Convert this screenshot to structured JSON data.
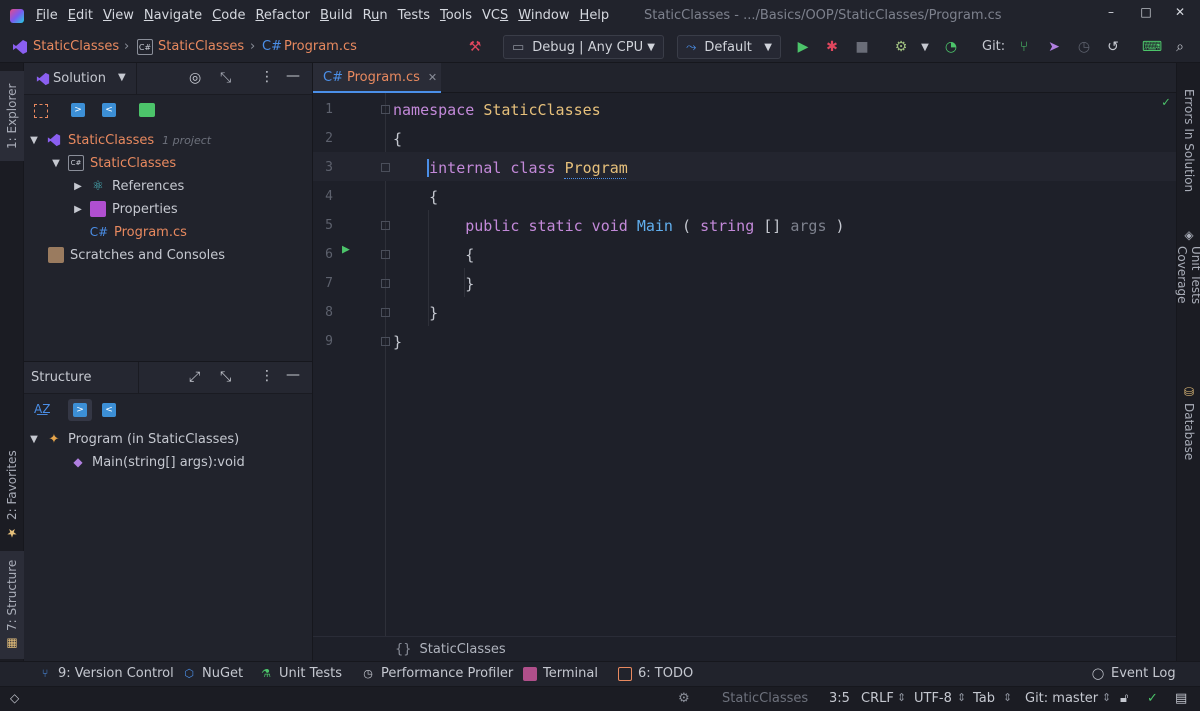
{
  "menu": {
    "items": [
      {
        "pre": "",
        "u": "F",
        "post": "ile"
      },
      {
        "pre": "",
        "u": "E",
        "post": "dit"
      },
      {
        "pre": "",
        "u": "V",
        "post": "iew"
      },
      {
        "pre": "",
        "u": "N",
        "post": "avigate"
      },
      {
        "pre": "",
        "u": "C",
        "post": "ode"
      },
      {
        "pre": "",
        "u": "R",
        "post": "efactor"
      },
      {
        "pre": "",
        "u": "B",
        "post": "uild"
      },
      {
        "pre": "R",
        "u": "u",
        "post": "n"
      },
      {
        "pre": "Tests",
        "u": "",
        "post": ""
      },
      {
        "pre": "",
        "u": "T",
        "post": "ools"
      },
      {
        "pre": "VC",
        "u": "S",
        "post": ""
      },
      {
        "pre": "",
        "u": "W",
        "post": "indow"
      },
      {
        "pre": "",
        "u": "H",
        "post": "elp"
      }
    ],
    "window_title": "StaticClasses - .../Basics/OOP/StaticClasses/Program.cs"
  },
  "nav": {
    "crumb_solution": "StaticClasses",
    "crumb_project": "StaticClasses",
    "crumb_file": "Program.cs",
    "config": "Debug | Any CPU",
    "run_config": "Default",
    "git_label": "Git:"
  },
  "left_stripe": {
    "explorer": "1: Explorer",
    "favorites": "2: Favorites",
    "structure": "7: Structure"
  },
  "solution": {
    "header": "Solution",
    "tree": [
      {
        "label": "StaticClasses",
        "hint": "1 project",
        "color": "#e8895f"
      },
      {
        "label": "StaticClasses",
        "color": "#e8895f"
      },
      {
        "label": "References",
        "color": "#c5c8d0"
      },
      {
        "label": "Properties",
        "color": "#c5c8d0"
      },
      {
        "label": "Program.cs",
        "color": "#e8895f"
      },
      {
        "label": "Scratches and Consoles",
        "color": "#c5c8d0"
      }
    ]
  },
  "structure": {
    "header": "Structure",
    "items": [
      {
        "label": "Program (in StaticClasses)"
      },
      {
        "label": "Main(string[] args):void"
      }
    ]
  },
  "editor": {
    "tab_label": "Program.cs",
    "tab_prefix": "C#",
    "line_numbers": [
      "1",
      "2",
      "3",
      "4",
      "5",
      "6",
      "7",
      "8",
      "9"
    ],
    "lines": [
      {
        "tokens": [
          {
            "t": "namespace ",
            "c": "kw"
          },
          {
            "t": "StaticClasses",
            "c": "cls"
          }
        ]
      },
      {
        "tokens": [
          {
            "t": "{",
            "c": ""
          }
        ]
      },
      {
        "tokens": [
          {
            "t": "    ",
            "c": ""
          },
          {
            "t": "internal class ",
            "c": "kw"
          },
          {
            "t": "Program",
            "c": "cls"
          }
        ]
      },
      {
        "tokens": [
          {
            "t": "    {",
            "c": ""
          }
        ]
      },
      {
        "tokens": [
          {
            "t": "        ",
            "c": ""
          },
          {
            "t": "public static void ",
            "c": "kw"
          },
          {
            "t": "Main",
            "c": "fn"
          },
          {
            "t": " ( ",
            "c": ""
          },
          {
            "t": "string",
            "c": "kw"
          },
          {
            "t": " [] ",
            "c": ""
          },
          {
            "t": "args",
            "c": "par"
          },
          {
            "t": " )",
            "c": ""
          }
        ]
      },
      {
        "tokens": [
          {
            "t": "        {",
            "c": ""
          }
        ]
      },
      {
        "tokens": [
          {
            "t": "        }",
            "c": ""
          }
        ]
      },
      {
        "tokens": [
          {
            "t": "    }",
            "c": ""
          }
        ]
      },
      {
        "tokens": [
          {
            "t": "}",
            "c": ""
          }
        ]
      }
    ],
    "footer_breadcrumb": "StaticClasses"
  },
  "right_stripe": {
    "errors": "Errors In Solution",
    "coverage": "Unit Tests Coverage",
    "database": "Database"
  },
  "bottom_tools": {
    "version_control": "9: Version Control",
    "nuget": "NuGet",
    "unit_tests": "Unit Tests",
    "profiler": "Performance Profiler",
    "terminal": "Terminal",
    "todo": "6: TODO",
    "event_log": "Event Log"
  },
  "status": {
    "project": "StaticClasses",
    "position": "3:5",
    "line_ending": "CRLF",
    "encoding": "UTF-8",
    "indent": "Tab",
    "git_branch": "Git: master"
  },
  "colors": {
    "accent": "#4b8fe8",
    "solution_icon": "#8a5ff0",
    "run_green": "#4cc46a",
    "debug_red": "#e0475e"
  }
}
